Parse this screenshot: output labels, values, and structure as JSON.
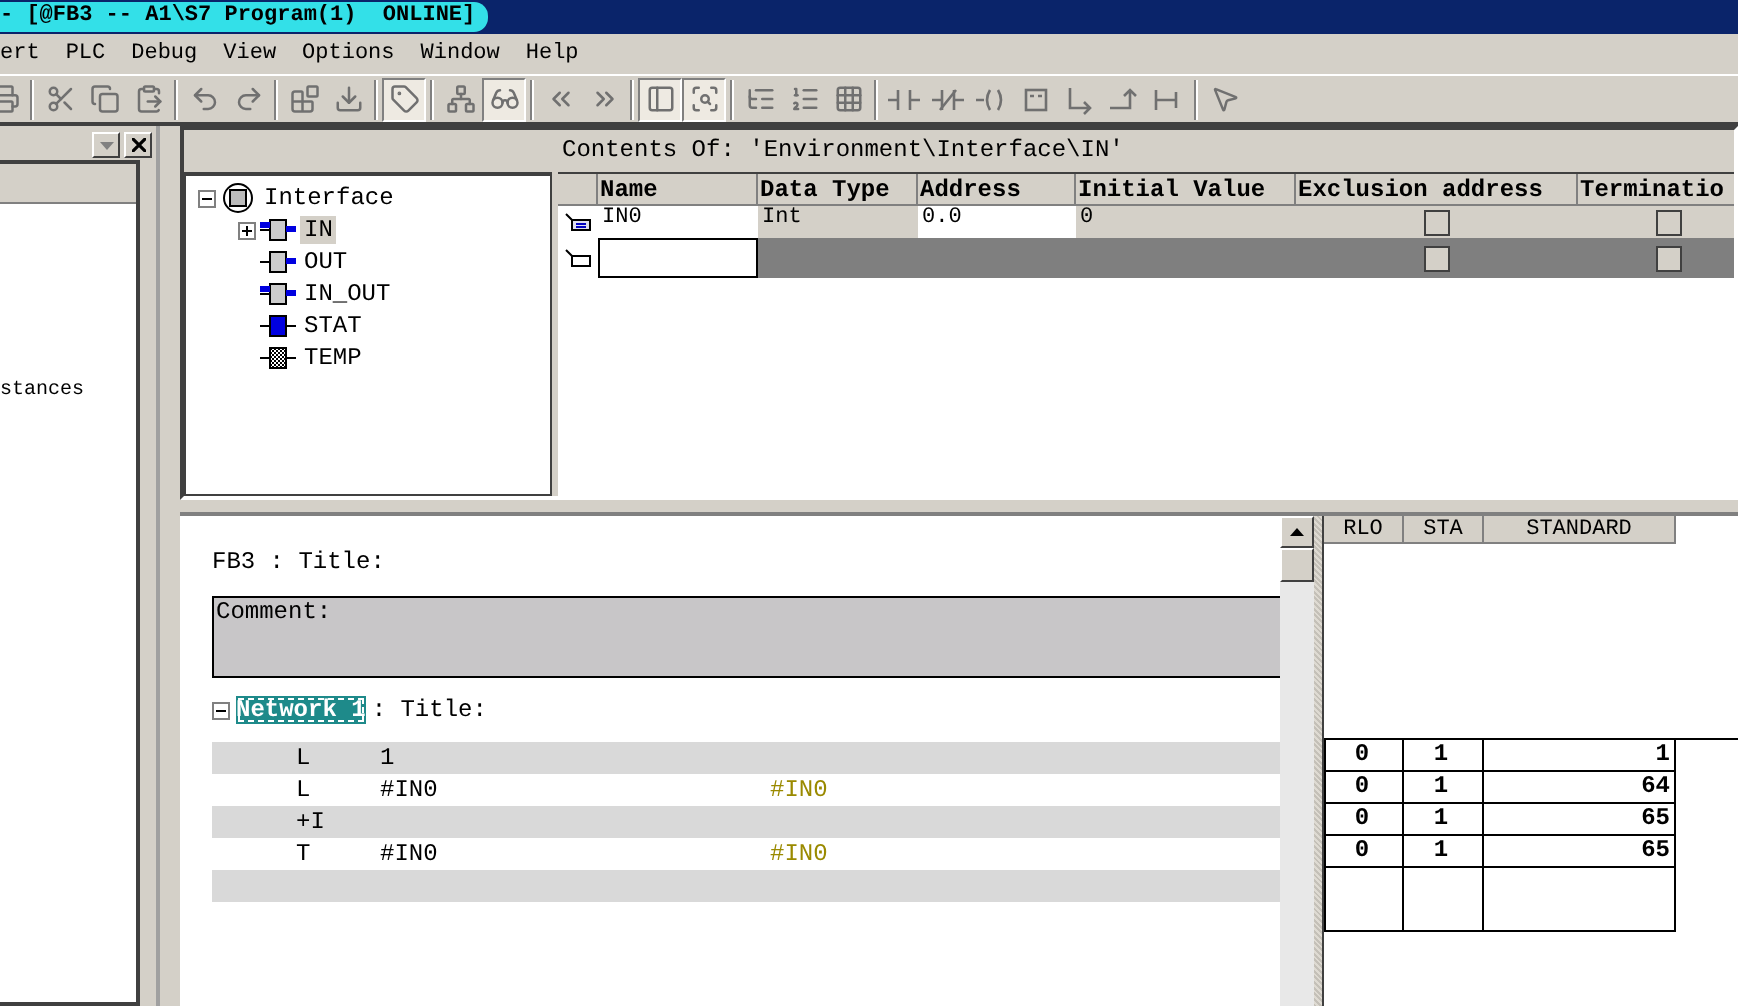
{
  "window": {
    "title": "- [@FB3 -- A1\\S7 Program(1)  ONLINE]",
    "online": true
  },
  "menu": [
    "ert",
    "PLC",
    "Debug",
    "View",
    "Options",
    "Window",
    "Help"
  ],
  "toolbar_groups": [
    [
      {
        "pressed": false
      }
    ],
    [
      {
        "pressed": false
      },
      {
        "pressed": false
      },
      {
        "pressed": false
      }
    ],
    [
      {
        "pressed": false
      },
      {
        "pressed": false
      }
    ],
    [
      {
        "pressed": false
      },
      {
        "pressed": false
      }
    ],
    [
      {
        "pressed": true
      }
    ],
    [
      {
        "pressed": false
      },
      {
        "pressed": true
      }
    ],
    [
      {
        "pressed": false
      },
      {
        "pressed": false
      }
    ],
    [
      {
        "pressed": true
      },
      {
        "pressed": true
      }
    ],
    [
      {
        "pressed": false
      },
      {
        "pressed": false
      },
      {
        "pressed": false
      }
    ],
    [
      {
        "pressed": false
      },
      {
        "pressed": false
      },
      {
        "pressed": false
      },
      {
        "pressed": false
      },
      {
        "pressed": false
      },
      {
        "pressed": false
      },
      {
        "pressed": false
      }
    ],
    [
      {
        "pressed": false
      }
    ]
  ],
  "left_pane": {
    "items": [
      "stances"
    ]
  },
  "tree": {
    "label": "Interface",
    "kind": "interface",
    "expanded": true,
    "selected": false,
    "children": [
      {
        "label": "IN",
        "kind": "in",
        "selected": true,
        "expanded": false
      },
      {
        "label": "OUT",
        "kind": "out",
        "selected": false
      },
      {
        "label": "IN_OUT",
        "kind": "in_out",
        "selected": false
      },
      {
        "label": "STAT",
        "kind": "stat",
        "selected": false
      },
      {
        "label": "TEMP",
        "kind": "temp",
        "selected": false
      }
    ]
  },
  "contents": {
    "path": "Contents Of: 'Environment\\Interface\\IN'",
    "columns": [
      "Name",
      "Data Type",
      "Address",
      "Initial Value",
      "Exclusion address",
      "Terminatio"
    ],
    "rows": [
      {
        "kind": "declaration",
        "name": "IN0",
        "data_type": "Int",
        "address": "0.0",
        "initial_value": "0",
        "exclusion_address": false,
        "termination": false
      },
      {
        "kind": "new",
        "exclusion_address": false,
        "termination": false
      }
    ]
  },
  "editor": {
    "block_title": "FB3 : Title:",
    "comment": "Comment:",
    "network": {
      "label": "Network 1",
      "title": ": Title:",
      "selected": true,
      "expanded": true
    },
    "lines": [
      {
        "kind": "instruction",
        "op": "L",
        "operand": "1"
      },
      {
        "kind": "instruction",
        "op": "L",
        "operand": "#IN0",
        "symbol": "#IN0"
      },
      {
        "kind": "instruction",
        "op": "+I"
      },
      {
        "kind": "instruction",
        "op": "T",
        "operand": "#IN0",
        "symbol": "#IN0"
      },
      {
        "kind": "empty"
      }
    ]
  },
  "status": {
    "columns": [
      "RLO",
      "STA",
      "STANDARD"
    ],
    "rows": [
      {
        "rlo": "0",
        "sta": "1",
        "standard": "1"
      },
      {
        "rlo": "0",
        "sta": "1",
        "standard": "64"
      },
      {
        "rlo": "0",
        "sta": "1",
        "standard": "65"
      },
      {
        "rlo": "0",
        "sta": "1",
        "standard": "65"
      }
    ]
  }
}
